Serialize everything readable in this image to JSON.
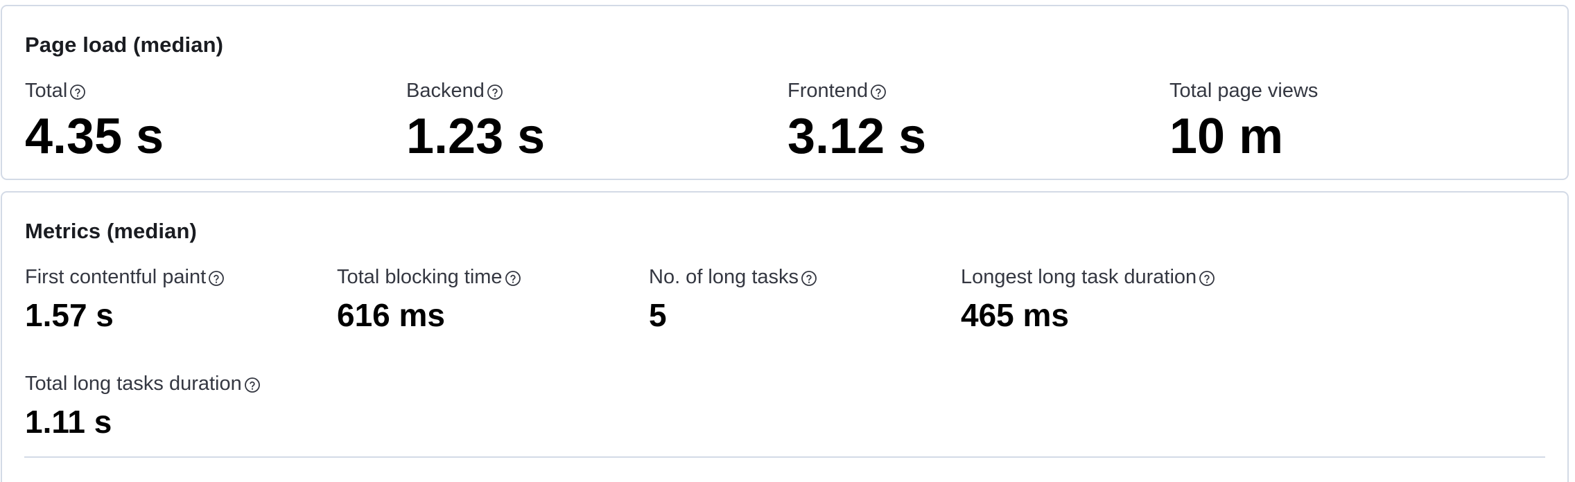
{
  "page_load": {
    "title": "Page load (median)",
    "stats": [
      {
        "label": "Total",
        "value": "4.35 s",
        "help": true
      },
      {
        "label": "Backend",
        "value": "1.23 s",
        "help": true
      },
      {
        "label": "Frontend",
        "value": "3.12 s",
        "help": true
      },
      {
        "label": "Total page views",
        "value": "10 m",
        "help": false
      }
    ]
  },
  "metrics": {
    "title": "Metrics (median)",
    "stats": [
      {
        "label": "First contentful paint",
        "value": "1.57 s",
        "help": true
      },
      {
        "label": "Total blocking time",
        "value": "616 ms",
        "help": true
      },
      {
        "label": "No. of long tasks",
        "value": "5",
        "help": true
      },
      {
        "label": "Longest long task duration",
        "value": "465 ms",
        "help": true
      },
      {
        "label": "Total long tasks duration",
        "value": "1.11 s",
        "help": true
      }
    ]
  },
  "icons": {
    "help": "question-in-circle-icon"
  },
  "colors": {
    "border": "#d3dae6",
    "text": "#1a1c21",
    "label": "#343741",
    "value": "#000000"
  }
}
